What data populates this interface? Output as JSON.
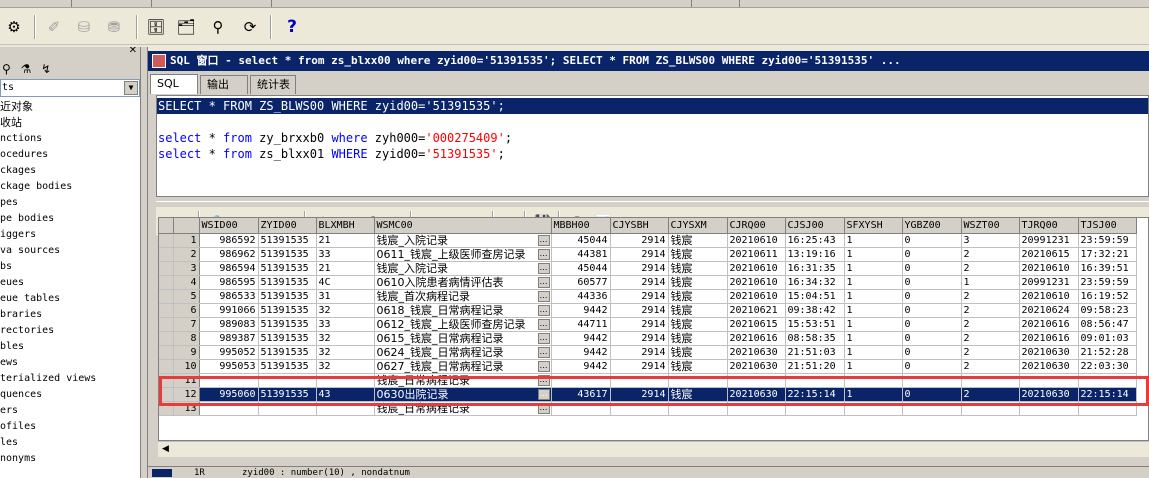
{
  "toolbar": {
    "buttons": [
      {
        "name": "gear-icon",
        "glyph": "⚙"
      },
      {
        "name": "wand-icon",
        "glyph": "✐"
      },
      {
        "name": "stack-icon",
        "glyph": "⛁"
      },
      {
        "name": "stack-up-icon",
        "glyph": "⛃"
      },
      {
        "name": "db-connect-icon",
        "glyph": "🗄"
      },
      {
        "name": "sql-icon",
        "glyph": "🗂"
      },
      {
        "name": "binoculars-icon",
        "glyph": "⚲"
      },
      {
        "name": "refresh-icon",
        "glyph": "⟳"
      }
    ],
    "help_glyph": "?"
  },
  "navigator": {
    "close_glyph": "✕",
    "tools_glyphs": "⚲ ⚗ ↯",
    "filter_value": "ts",
    "items": [
      "近对象",
      "收站",
      "nctions",
      "ocedures",
      "ckages",
      "ckage bodies",
      "pes",
      "pe bodies",
      "iggers",
      "va sources",
      "bs",
      "eues",
      "eue tables",
      "braries",
      "rectories",
      "bles",
      "ews",
      "terialized views",
      "quences",
      "ers",
      "ofiles",
      "les",
      "nonyms"
    ]
  },
  "window": {
    "title": "SQL 窗口 - select * from zs_blxx00 where zyid00='51391535'; SELECT * FROM ZS_BLWS00 WHERE zyid00='51391535' ..."
  },
  "tabs": [
    "SQL",
    "输出",
    "统计表"
  ],
  "editor": {
    "lines": [
      [
        {
          "c": "kw",
          "t": "SELECT"
        },
        {
          "c": "plain",
          "t": " * "
        },
        {
          "c": "kw",
          "t": "FROM"
        },
        {
          "c": "plain",
          "t": " ZS_BLWS00 "
        },
        {
          "c": "kw",
          "t": "WHERE"
        },
        {
          "c": "plain",
          "t": " zyid00="
        },
        {
          "c": "str",
          "t": "'51391535'"
        },
        {
          "c": "plain",
          "t": ";"
        }
      ],
      [],
      [
        {
          "c": "kw",
          "t": "select"
        },
        {
          "c": "plain",
          "t": " * "
        },
        {
          "c": "kw",
          "t": "from"
        },
        {
          "c": "plain",
          "t": " zy_brxxb0 "
        },
        {
          "c": "kw",
          "t": "where"
        },
        {
          "c": "plain",
          "t": " zyh000="
        },
        {
          "c": "str",
          "t": "'000275409'"
        },
        {
          "c": "plain",
          "t": ";"
        }
      ],
      [
        {
          "c": "kw",
          "t": "select"
        },
        {
          "c": "plain",
          "t": " * "
        },
        {
          "c": "kw",
          "t": "from"
        },
        {
          "c": "plain",
          "t": " zs_blxx01 "
        },
        {
          "c": "kw",
          "t": "WHERE"
        },
        {
          "c": "plain",
          "t": " zyid00="
        },
        {
          "c": "str",
          "t": "'51391535'"
        },
        {
          "c": "plain",
          "t": ";"
        }
      ]
    ],
    "selected_line": 0
  },
  "grid_toolbar": [
    {
      "name": "grid-icon",
      "glyph": "▦",
      "dis": false
    },
    {
      "name": "lock-icon",
      "glyph": "🔒",
      "dis": false
    },
    {
      "name": "add-row-icon",
      "glyph": "+",
      "dis": true
    },
    {
      "name": "delete-row-icon",
      "glyph": "−",
      "dis": true
    },
    {
      "name": "post-icon",
      "glyph": "✔",
      "dis": true
    },
    {
      "name": "fetch-next-icon",
      "glyph": "⇣",
      "dis": true
    },
    {
      "name": "fetch-last-icon",
      "glyph": "⤓",
      "dis": true
    },
    {
      "name": "find-icon",
      "glyph": "⚲",
      "dis": false
    },
    {
      "name": "clear-icon",
      "glyph": "✎",
      "dis": true
    },
    {
      "name": "query-icon",
      "glyph": "◈",
      "dis": false
    },
    {
      "name": "prev-icon",
      "glyph": "▽",
      "dis": true
    },
    {
      "name": "next-icon",
      "glyph": "△",
      "dis": true
    },
    {
      "name": "tree-icon",
      "glyph": "⧉",
      "dis": false
    },
    {
      "name": "save-icon",
      "glyph": "💾",
      "dis": false
    },
    {
      "name": "export-icon",
      "glyph": "⛁",
      "dis": false
    },
    {
      "name": "chart-icon",
      "glyph": "📊",
      "dis": false
    }
  ],
  "grid": {
    "columns": [
      "WSID00",
      "ZYID00",
      "BLXMBH",
      "WSMC00",
      "MBBH00",
      "CJYSBH",
      "CJYSXM",
      "CJRQ00",
      "CJSJ00",
      "SFXYSH",
      "YGBZ00",
      "WSZT00",
      "TJRQ00",
      "TJSJ00"
    ],
    "rows": [
      [
        "1",
        "986592",
        "51391535",
        "21",
        "钱宸_入院记录",
        "45044",
        "2914",
        "钱宸",
        "20210610",
        "16:25:43",
        "1",
        "0",
        "3",
        "20991231",
        "23:59:59"
      ],
      [
        "2",
        "986962",
        "51391535",
        "33",
        "0611_钱宸_上级医师查房记录",
        "44381",
        "2914",
        "钱宸",
        "20210611",
        "13:19:16",
        "1",
        "0",
        "2",
        "20210615",
        "17:32:21"
      ],
      [
        "3",
        "986594",
        "51391535",
        "21",
        "钱宸_入院记录",
        "45044",
        "2914",
        "钱宸",
        "20210610",
        "16:31:35",
        "1",
        "0",
        "2",
        "20210610",
        "16:39:51"
      ],
      [
        "4",
        "986595",
        "51391535",
        "4C",
        "0610入院患者病情评估表",
        "60577",
        "2914",
        "钱宸",
        "20210610",
        "16:34:32",
        "1",
        "0",
        "1",
        "20991231",
        "23:59:59"
      ],
      [
        "5",
        "986533",
        "51391535",
        "31",
        "钱宸_首次病程记录",
        "44336",
        "2914",
        "钱宸",
        "20210610",
        "15:04:51",
        "1",
        "0",
        "2",
        "20210610",
        "16:19:52"
      ],
      [
        "6",
        "991066",
        "51391535",
        "32",
        "0618_钱宸_日常病程记录",
        "9442",
        "2914",
        "钱宸",
        "20210621",
        "09:38:42",
        "1",
        "0",
        "2",
        "20210624",
        "09:58:23"
      ],
      [
        "7",
        "989083",
        "51391535",
        "33",
        "0612_钱宸_上级医师查房记录",
        "44711",
        "2914",
        "钱宸",
        "20210615",
        "15:53:51",
        "1",
        "0",
        "2",
        "20210616",
        "08:56:47"
      ],
      [
        "8",
        "989387",
        "51391535",
        "32",
        "0615_钱宸_日常病程记录",
        "9442",
        "2914",
        "钱宸",
        "20210616",
        "08:58:35",
        "1",
        "0",
        "2",
        "20210616",
        "09:01:03"
      ],
      [
        "9",
        "995052",
        "51391535",
        "32",
        "0624_钱宸_日常病程记录",
        "9442",
        "2914",
        "钱宸",
        "20210630",
        "21:51:03",
        "1",
        "0",
        "2",
        "20210630",
        "21:52:28"
      ],
      [
        "10",
        "995053",
        "51391535",
        "32",
        "0627_钱宸_日常病程记录",
        "9442",
        "2914",
        "钱宸",
        "20210630",
        "21:51:20",
        "1",
        "0",
        "2",
        "20210630",
        "22:03:30"
      ],
      [
        "11",
        "",
        "",
        "",
        "钱宸_日常病程记录",
        "",
        "",
        "",
        "",
        "",
        "",
        "",
        "",
        "",
        ""
      ],
      [
        "12",
        "995060",
        "51391535",
        "43",
        "0630出院记录",
        "43617",
        "2914",
        "钱宸",
        "20210630",
        "22:15:14",
        "1",
        "0",
        "2",
        "20210630",
        "22:15:14"
      ],
      [
        "13",
        "",
        "",
        "",
        "钱宸_日常病程记录",
        "",
        "",
        "",
        "",
        "",
        "",
        "",
        "",
        "",
        ""
      ]
    ],
    "selected_row": 11
  },
  "scroll_left_glyph": "◀",
  "status": {
    "cell1": "1R",
    "cell2": "zyid00 : number(10) , nondatnum"
  }
}
